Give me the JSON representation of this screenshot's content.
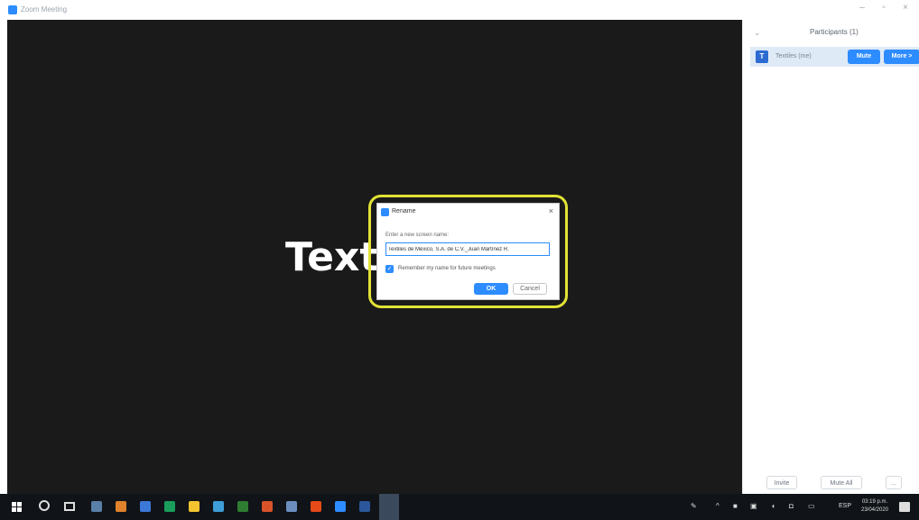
{
  "window": {
    "title": "Zoom Meeting",
    "controls": {
      "minimize": "–",
      "maximize": "▫",
      "close": "×"
    }
  },
  "video": {
    "participant_name": "Text"
  },
  "participants_panel": {
    "title": "Participants (1)",
    "collapse_icon": "⌄",
    "participants": [
      {
        "avatar_letter": "T",
        "name": "Textiles (me)",
        "mute_label": "Mute",
        "more_label": "More >"
      }
    ],
    "footer": {
      "invite": "Invite",
      "unmute_all": "Mute All",
      "more": "..."
    }
  },
  "rename_dialog": {
    "title": "Rename",
    "close": "×",
    "label": "Enter a new screen name:",
    "input_value": "Textiles de México, S.A. de C.V._Juan Martínez R.",
    "remember_label": "Remember my name for future meetings",
    "remember_checked": true,
    "ok_label": "OK",
    "cancel_label": "Cancel"
  },
  "taskbar": {
    "tray": {
      "language": "ESP",
      "time": "03:19 p.m.",
      "date": "23/04/2020"
    },
    "icon_colors": [
      "#5a7fa8",
      "#e0822c",
      "#3c78d8",
      "#1a9e5c",
      "#f4c430",
      "#3d9ed8",
      "#2e7d32",
      "#d9532a",
      "#6c8ebf",
      "#e64a19",
      "#2d8cff",
      "#2b579a"
    ]
  },
  "colors": {
    "accent": "#2d8cff",
    "highlight": "#e2e335",
    "video_bg": "#1a1a1a"
  }
}
